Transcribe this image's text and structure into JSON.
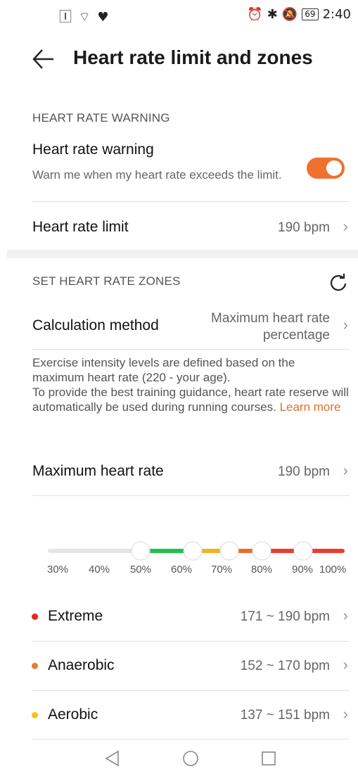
{
  "status_bar": {
    "left_icons": "🄸 ⌔ ♥",
    "alarm": "⏰",
    "bt": "✱",
    "mute": "🔕",
    "battery": "69",
    "time": "2:40"
  },
  "header": {
    "title": "Heart rate limit and zones"
  },
  "warning_section": {
    "heading": "HEART RATE WARNING",
    "toggle_title": "Heart rate warning",
    "toggle_subtitle": "Warn me when my heart rate exceeds the limit.",
    "toggle_on": true,
    "limit_label": "Heart rate limit",
    "limit_value": "190 bpm"
  },
  "zones_section": {
    "heading": "SET HEART RATE ZONES",
    "calc_label": "Calculation method",
    "calc_value_line1": "Maximum heart rate",
    "calc_value_line2": "percentage",
    "desc_line1": "Exercise intensity levels are defined based on the maximum heart rate (220 - your age).",
    "desc_line2": "To provide the best training guidance, heart rate reserve will automatically be used during running courses.",
    "learn_more": "Learn more",
    "max_label": "Maximum heart rate",
    "max_value": "190 bpm"
  },
  "slider": {
    "ticks": [
      "30%",
      "40%",
      "50%",
      "60%",
      "70%",
      "80%",
      "90%",
      "100%"
    ],
    "thumb_positions_pct": [
      50,
      60,
      70,
      80,
      90
    ],
    "colors": {
      "gray": "#e5e5e5",
      "green": "#22c04a",
      "yellow": "#f2b21c",
      "orange": "#ef6a2a",
      "red": "#ef3a2c"
    }
  },
  "zones": [
    {
      "name": "Extreme",
      "range": "171 ~ 190 bpm",
      "color": "#e8242a"
    },
    {
      "name": "Anaerobic",
      "range": "152 ~ 170 bpm",
      "color": "#ea7a2c"
    },
    {
      "name": "Aerobic",
      "range": "137 ~ 151 bpm",
      "color": "#f4c21e"
    }
  ],
  "nav": {
    "back": "◁",
    "home": "○",
    "recent": "□"
  }
}
